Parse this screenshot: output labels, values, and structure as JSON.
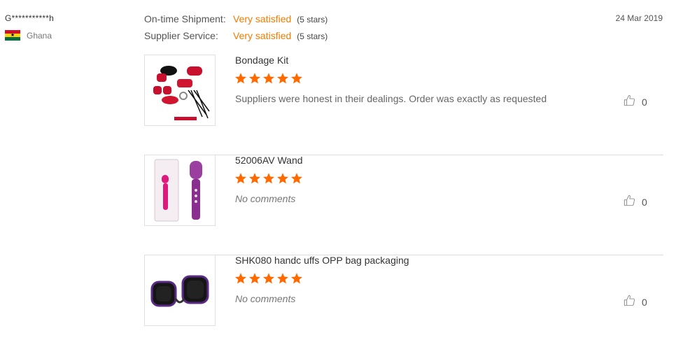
{
  "reviewer": {
    "name": "G***********h",
    "country": "Ghana",
    "flag_icon": "ghana-flag-icon"
  },
  "ratings": [
    {
      "label": "On-time Shipment:",
      "value": "Very satisfied",
      "stars_text": "(5 stars)"
    },
    {
      "label": "Supplier Service:",
      "value": "Very satisfied",
      "stars_text": "(5 stars)"
    }
  ],
  "date": "24 Mar 2019",
  "items": [
    {
      "name": "Bondage Kit",
      "rating": 5,
      "comment": "Suppliers were honest in their dealings. Order was exactly as requested",
      "likes": "0"
    },
    {
      "name": "52006AV Wand",
      "rating": 5,
      "comment": "No comments",
      "likes": "0"
    },
    {
      "name": "SHK080 handc uffs OPP bag packaging",
      "rating": 5,
      "comment": "No comments",
      "likes": "0"
    }
  ],
  "colors": {
    "accent": "#f07c00",
    "star": "#ff6a00",
    "divider": "#dddddd"
  }
}
